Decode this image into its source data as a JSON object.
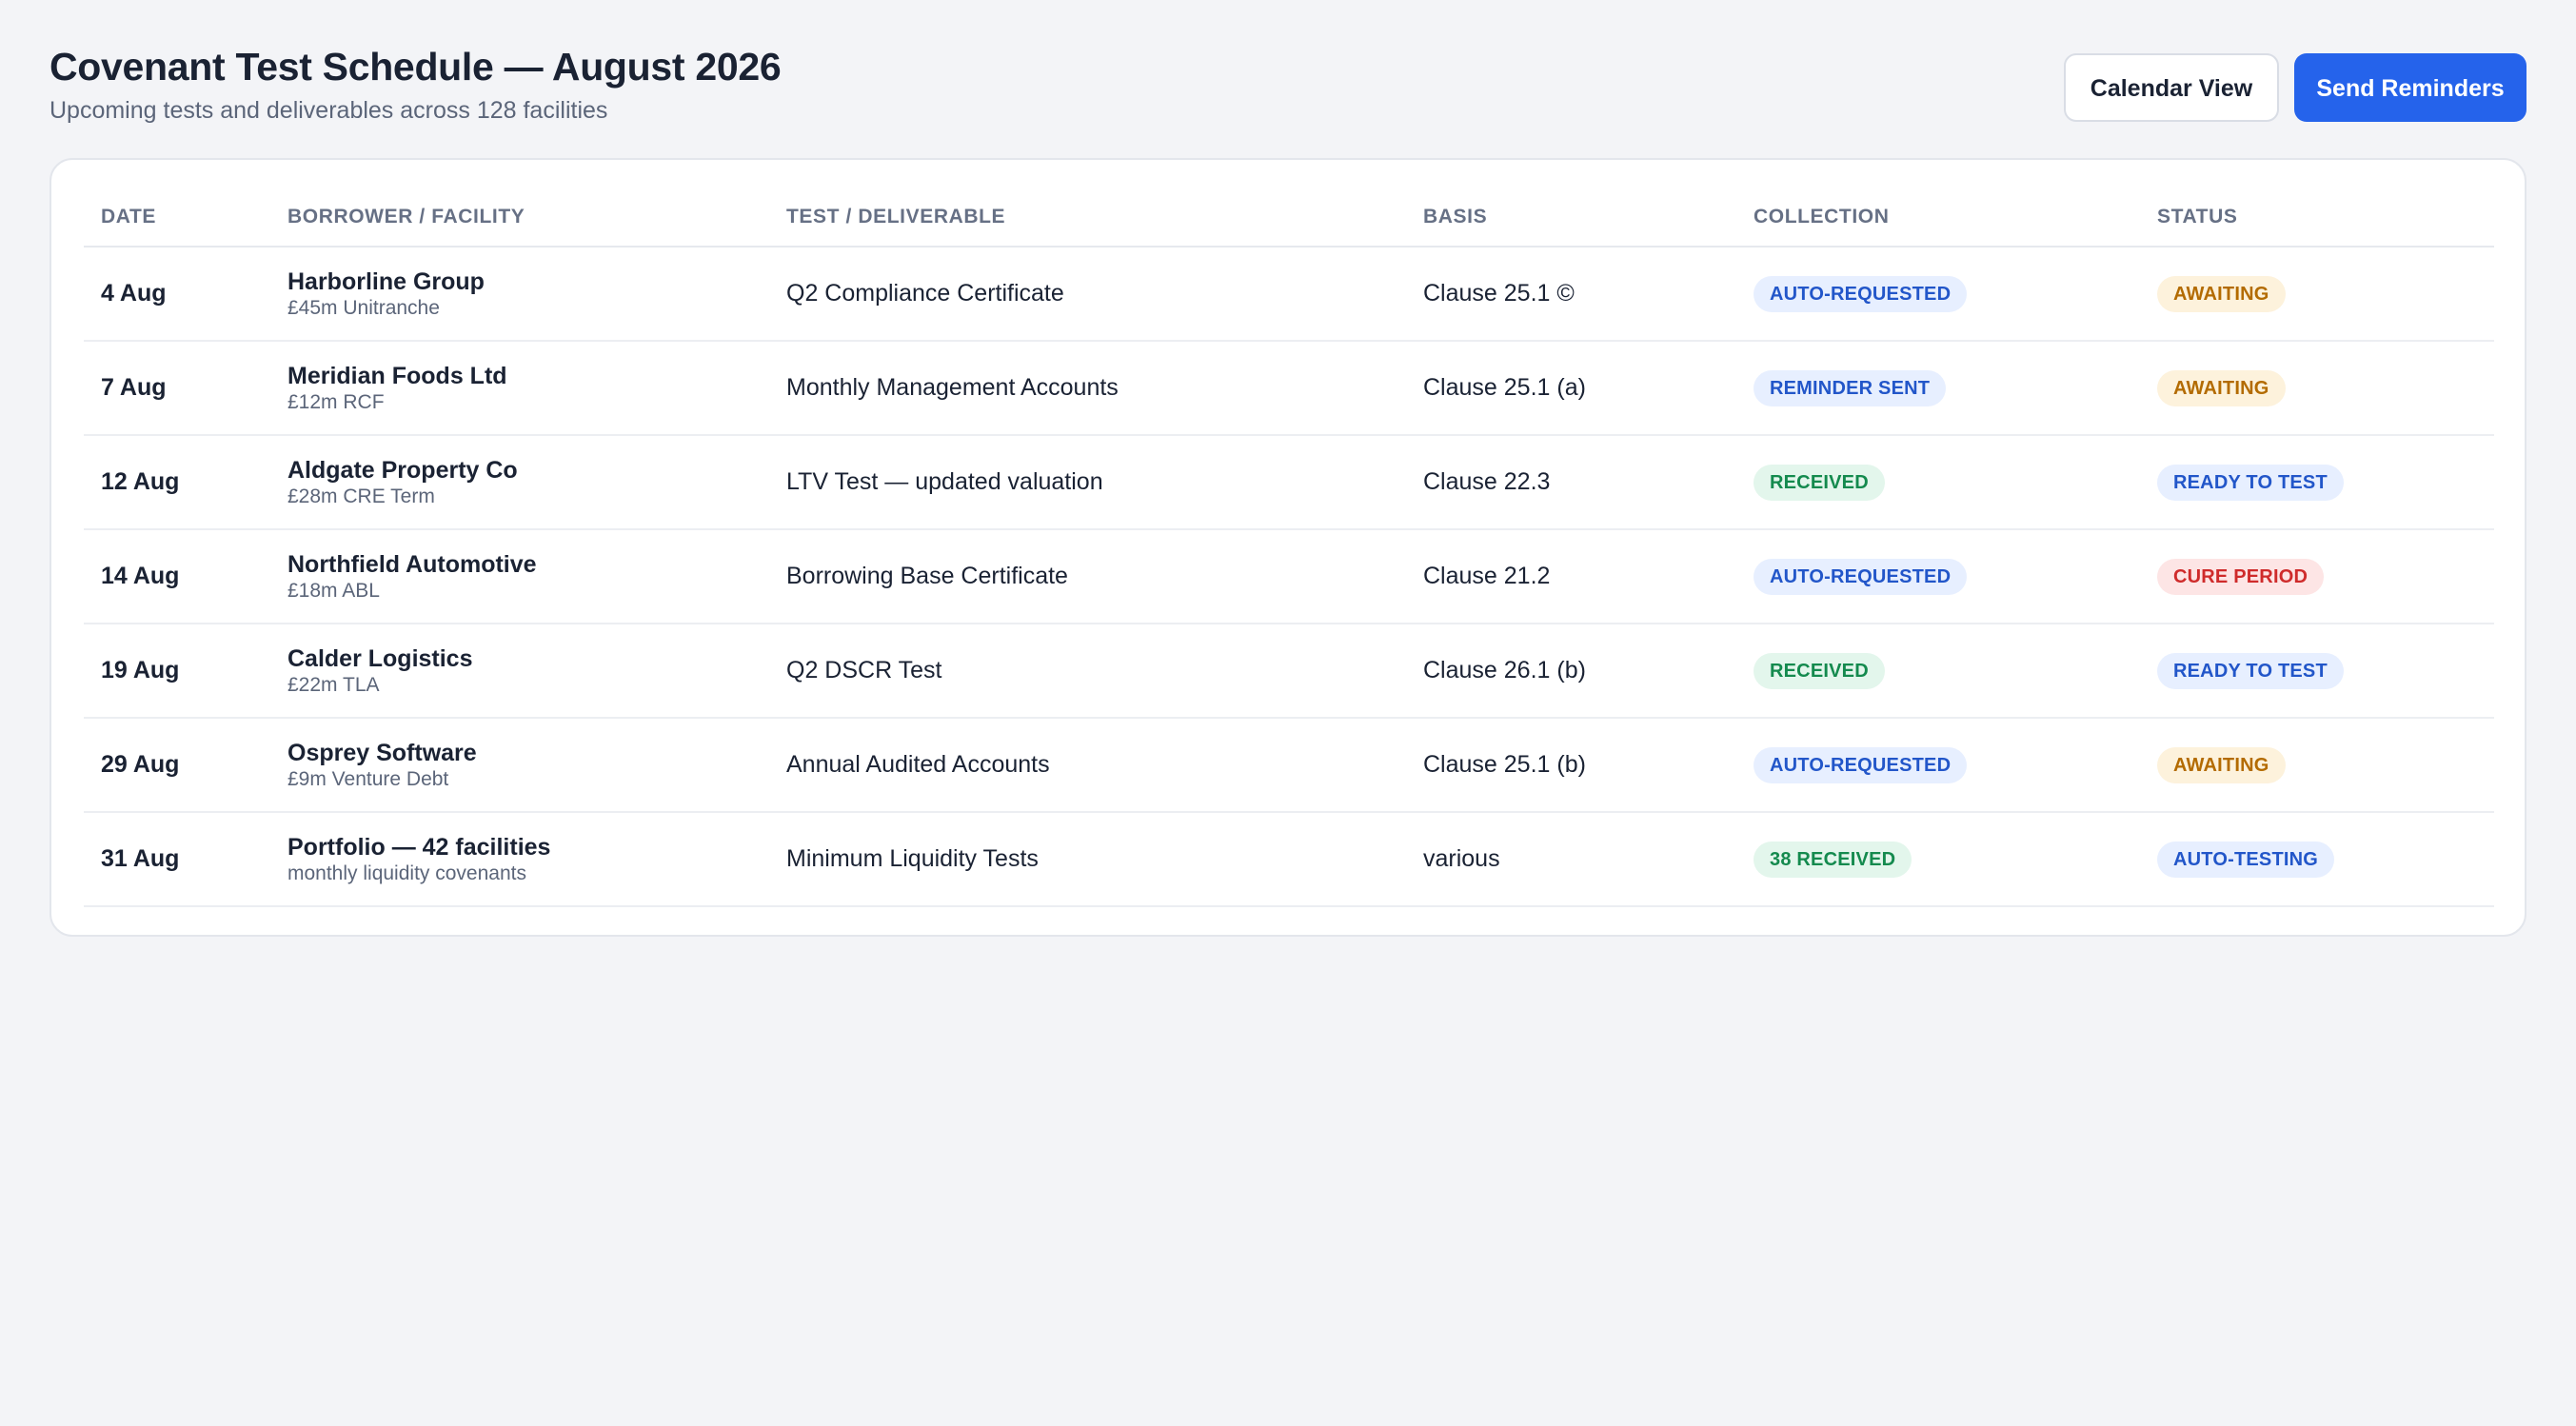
{
  "header": {
    "title": "Covenant Test Schedule — August 2026",
    "subtitle": "Upcoming tests and deliverables across 128 facilities",
    "calendar_view_label": "Calendar View",
    "send_reminders_label": "Send Reminders"
  },
  "colors": {
    "primary": "#2563eb",
    "pill_blue_bg": "#e7efff",
    "pill_blue_text": "#2256c9",
    "pill_green_bg": "#e3f6ec",
    "pill_green_text": "#148a4e",
    "pill_amber_bg": "#fdf2dc",
    "pill_amber_text": "#b36b00",
    "pill_red_bg": "#fde5e5",
    "pill_red_text": "#cf2b2b"
  },
  "table": {
    "columns": {
      "date": "DATE",
      "borrower": "BORROWER / FACILITY",
      "test": "TEST / DELIVERABLE",
      "basis": "BASIS",
      "collection": "COLLECTION",
      "status": "STATUS"
    },
    "rows": [
      {
        "date": "4 Aug",
        "borrower": "Harborline Group",
        "facility": "£45m Unitranche",
        "test": "Q2 Compliance Certificate",
        "basis": "Clause 25.1 ©",
        "collection": "AUTO-REQUESTED",
        "collection_tone": "blue",
        "status": "AWAITING",
        "status_tone": "amber"
      },
      {
        "date": "7 Aug",
        "borrower": "Meridian Foods Ltd",
        "facility": "£12m RCF",
        "test": "Monthly Management Accounts",
        "basis": "Clause 25.1 (a)",
        "collection": "REMINDER SENT",
        "collection_tone": "blue",
        "status": "AWAITING",
        "status_tone": "amber"
      },
      {
        "date": "12 Aug",
        "borrower": "Aldgate Property Co",
        "facility": "£28m CRE Term",
        "test": "LTV Test — updated valuation",
        "basis": "Clause 22.3",
        "collection": "RECEIVED",
        "collection_tone": "green",
        "status": "READY TO TEST",
        "status_tone": "blue"
      },
      {
        "date": "14 Aug",
        "borrower": "Northfield Automotive",
        "facility": "£18m ABL",
        "test": "Borrowing Base Certificate",
        "basis": "Clause 21.2",
        "collection": "AUTO-REQUESTED",
        "collection_tone": "blue",
        "status": "CURE PERIOD",
        "status_tone": "red"
      },
      {
        "date": "19 Aug",
        "borrower": "Calder Logistics",
        "facility": "£22m TLA",
        "test": "Q2 DSCR Test",
        "basis": "Clause 26.1 (b)",
        "collection": "RECEIVED",
        "collection_tone": "green",
        "status": "READY TO TEST",
        "status_tone": "blue"
      },
      {
        "date": "29 Aug",
        "borrower": "Osprey Software",
        "facility": "£9m Venture Debt",
        "test": "Annual Audited Accounts",
        "basis": "Clause 25.1 (b)",
        "collection": "AUTO-REQUESTED",
        "collection_tone": "blue",
        "status": "AWAITING",
        "status_tone": "amber"
      },
      {
        "date": "31 Aug",
        "borrower": "Portfolio — 42 facilities",
        "facility": "monthly liquidity covenants",
        "test": "Minimum Liquidity Tests",
        "basis": "various",
        "collection": "38 RECEIVED",
        "collection_tone": "green",
        "status": "AUTO-TESTING",
        "status_tone": "blue"
      }
    ]
  }
}
